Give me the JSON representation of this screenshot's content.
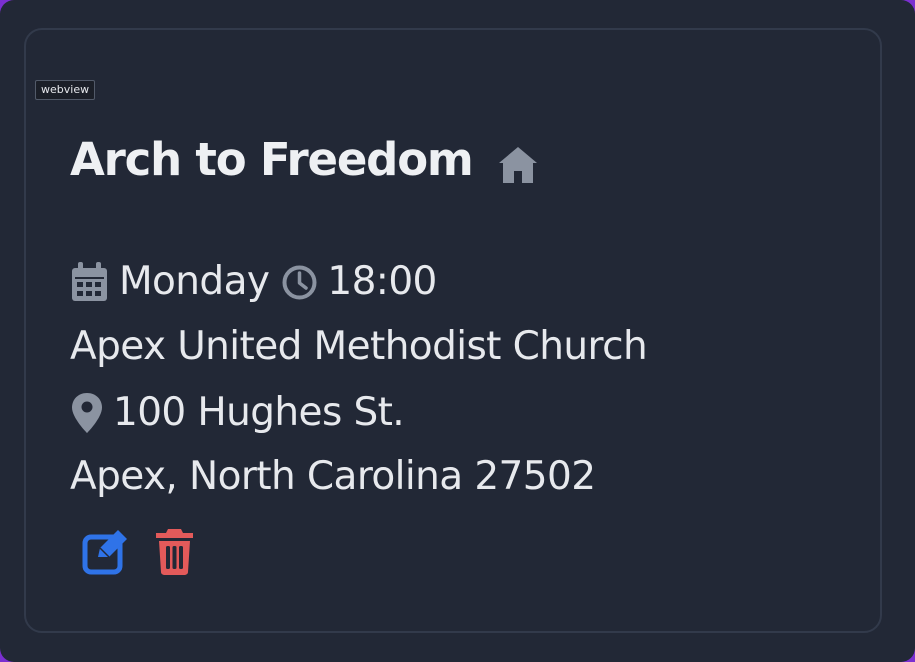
{
  "tooltip": {
    "label": "webview"
  },
  "meeting": {
    "title": "Arch to Freedom",
    "day": "Monday",
    "time": "18:00",
    "location_name": "Apex United Methodist Church",
    "street": "100 Hughes St.",
    "city_state_zip": "Apex, North Carolina 27502"
  },
  "icons": {
    "title_icon": "home-icon",
    "day_icon": "calendar-icon",
    "time_icon": "clock-icon",
    "address_icon": "map-pin-icon",
    "edit_icon": "edit-icon",
    "delete_icon": "trash-icon"
  },
  "colors": {
    "window_background": "#222836",
    "card_border": "#323a4b",
    "primary_text": "#e7e9ed",
    "icon_gray": "#8b93a1",
    "edit_blue": "#2f73e8",
    "delete_red": "#e35a5a"
  }
}
